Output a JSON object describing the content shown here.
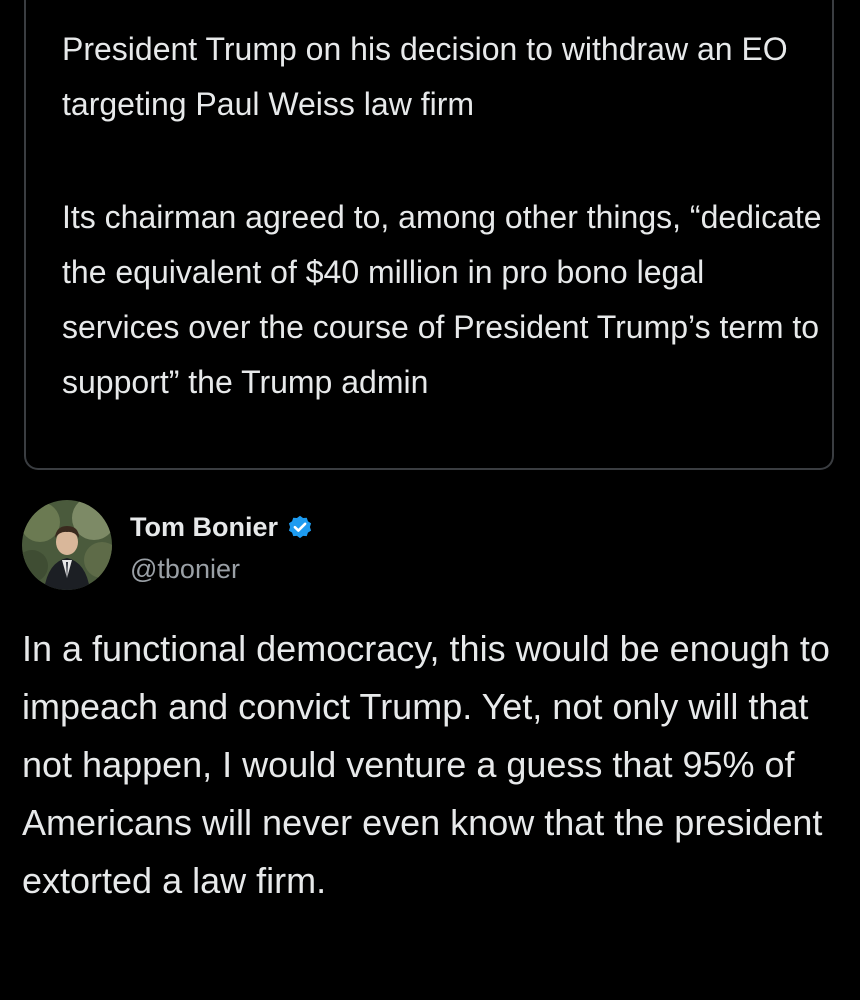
{
  "quoted_tweet": {
    "paragraphs": [
      "President Trump on his decision to withdraw an EO targeting Paul Weiss law firm",
      "Its chairman agreed to, among other things, “dedicate the equivalent of $40 million in pro bono legal services over the course of President Trump’s term to support” the Trump admin"
    ]
  },
  "author": {
    "name": "Tom Bonier",
    "handle": "@tbonier",
    "verified_icon": "verified-badge-icon",
    "verified_color": "#1d9bf0"
  },
  "tweet": {
    "text": "In a functional democracy, this would be enough to impeach and convict Trump. Yet, not only will that not happen, I would venture a guess that 95% of Americans will never even know that the president extorted a law firm."
  },
  "colors": {
    "background": "#000000",
    "text": "#e7e9ea",
    "secondary_text": "#9aa0a6",
    "card_border": "#3a3d41"
  }
}
